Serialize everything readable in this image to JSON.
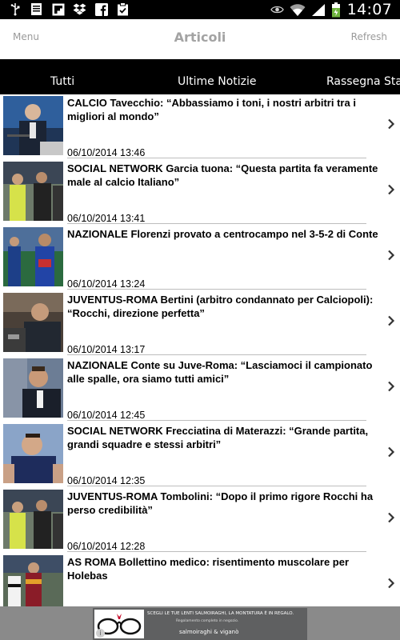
{
  "status_bar": {
    "time": "14:07",
    "left_icons": [
      "usb-icon",
      "document-icon",
      "flipboard-icon",
      "dropbox-icon",
      "facebook-icon",
      "clipboard-check-icon"
    ],
    "right_icons": [
      "eye-icon",
      "wifi-icon",
      "signal-icon",
      "battery-icon"
    ]
  },
  "navbar": {
    "menu_label": "Menu",
    "title": "Articoli",
    "refresh_label": "Refresh"
  },
  "tabs": [
    {
      "label": "Tutti"
    },
    {
      "label": "Ultime Notizie"
    },
    {
      "label": "Rassegna Stampa"
    }
  ],
  "articles": [
    {
      "title": "CALCIO Tavecchio: “Abbassiamo i toni, i nostri arbitri tra i migliori al mondo”",
      "date": "06/10/2014 13:46"
    },
    {
      "title": "SOCIAL NETWORK Garcia tuona: “Questa partita fa veramente male al calcio Italiano”",
      "date": "06/10/2014 13:41"
    },
    {
      "title": "NAZIONALE Florenzi provato a centrocampo nel 3-5-2 di Conte",
      "date": "06/10/2014 13:24"
    },
    {
      "title": "JUVENTUS-ROMA Bertini (arbitro condannato per Calciopoli): “Rocchi, direzione perfetta”",
      "date": "06/10/2014 13:17"
    },
    {
      "title": "NAZIONALE Conte su Juve-Roma: “Lasciamoci il campionato alle spalle, ora siamo tutti amici”",
      "date": "06/10/2014 12:45"
    },
    {
      "title": "SOCIAL NETWORK Frecciatina di Materazzi: “Grande partita, grandi squadre e stessi arbitri”",
      "date": "06/10/2014 12:35"
    },
    {
      "title": "JUVENTUS-ROMA Tombolini: “Dopo il primo rigore Rocchi ha perso credibilità”",
      "date": "06/10/2014 12:28"
    },
    {
      "title": "AS ROMA Bollettino medico: risentimento muscolare per Holebas",
      "date": ""
    }
  ],
  "ad": {
    "headline": "SCEGLI LE TUE LENTI SALMOIRAGHI, LA MONTATURA È IN REGALO.",
    "subtext": "Regolamento completo in negozio.",
    "brand": "salmoiraghi & viganò",
    "info_glyph": "i"
  },
  "colors": {
    "status_bar_bg": "#000000",
    "tab_bar_bg": "#000000",
    "nav_text": "#a3a3a3",
    "ad_bg": "#8a8a8a"
  }
}
